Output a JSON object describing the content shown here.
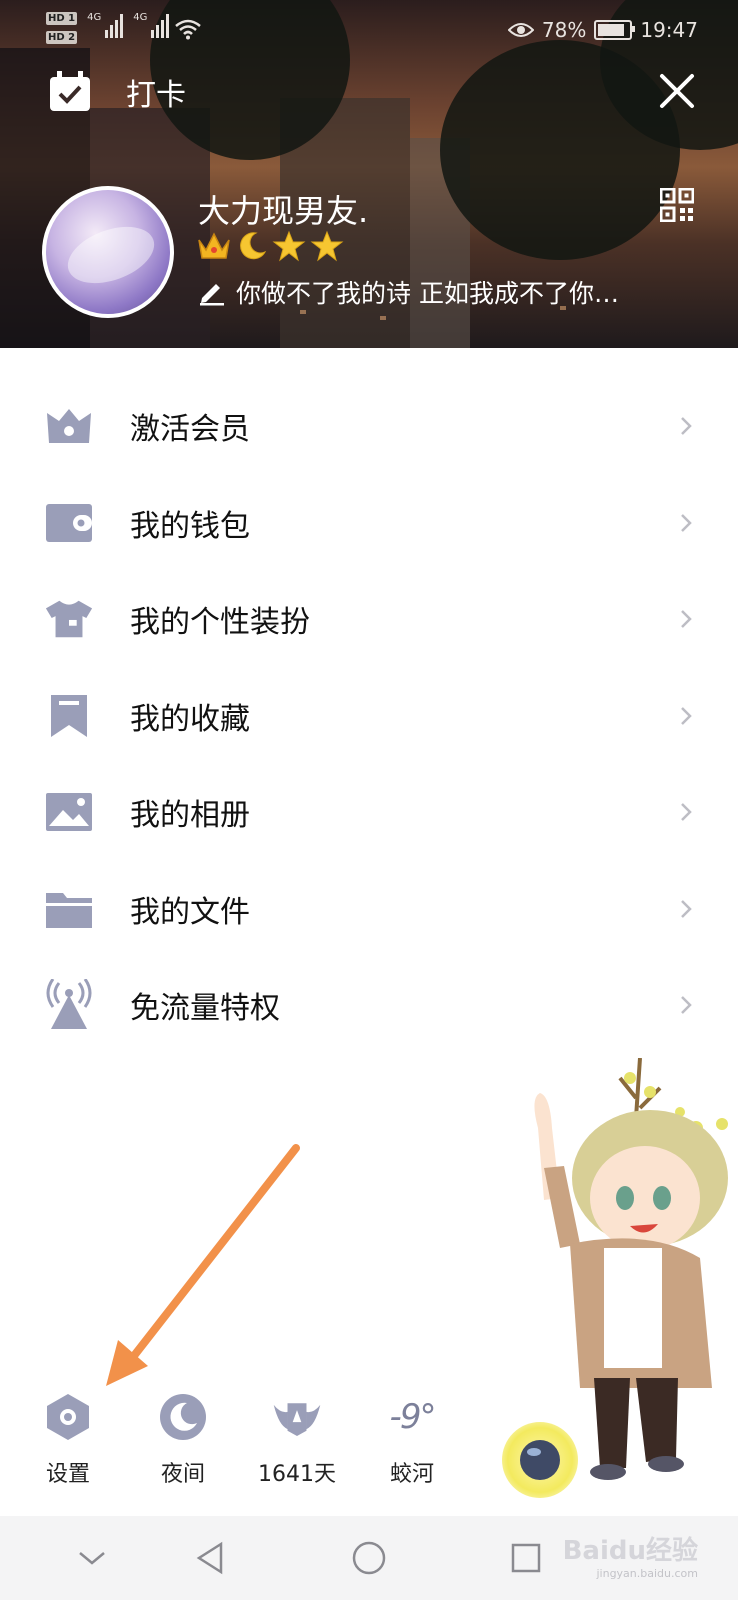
{
  "status_bar": {
    "hd1": "HD 1",
    "hd2": "HD 2",
    "net1": "4G",
    "net2": "4G",
    "battery": "78%",
    "time": "19:47"
  },
  "header": {
    "checkin_label": "打卡",
    "user_name": "大力现男友.",
    "signature": "你做不了我的诗 正如我成不了你…"
  },
  "menu": {
    "items": [
      {
        "label": "激活会员"
      },
      {
        "label": "我的钱包"
      },
      {
        "label": "我的个性装扮"
      },
      {
        "label": "我的收藏"
      },
      {
        "label": "我的相册"
      },
      {
        "label": "我的文件"
      },
      {
        "label": "免流量特权"
      }
    ]
  },
  "toolbar": {
    "settings": "设置",
    "night": "夜间",
    "days": "1641天",
    "weather_temp": "-9°",
    "weather_city": "蛟河"
  },
  "watermark": {
    "brand": "Baidu经验",
    "url": "jingyan.baidu.com"
  },
  "colors": {
    "icon": "#9a9eb8",
    "arrow": "#f2914a",
    "text": "#111111"
  }
}
